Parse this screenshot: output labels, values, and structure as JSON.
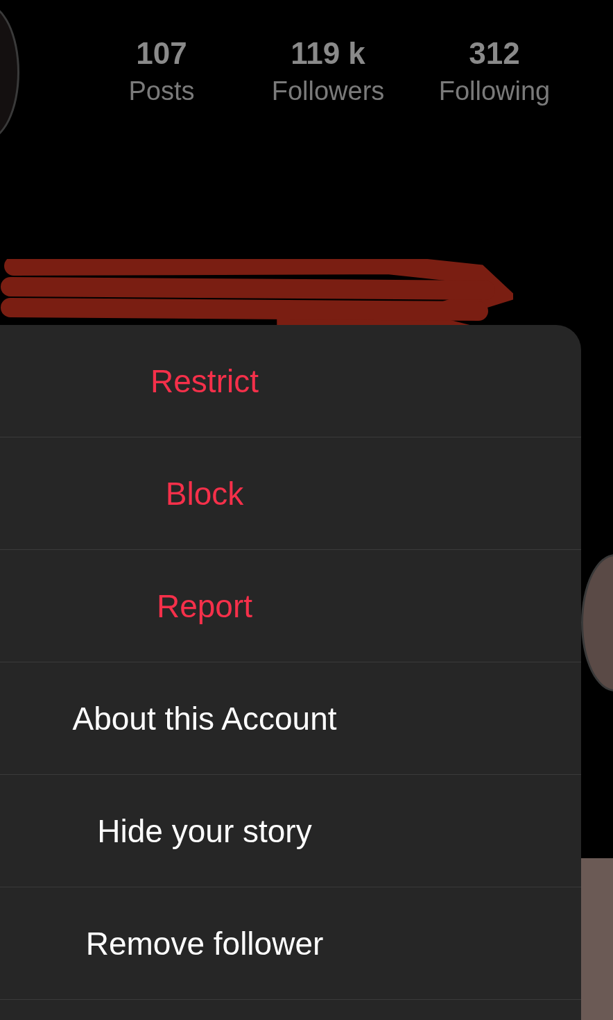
{
  "profile_stats": [
    {
      "value": "107",
      "label": "Posts"
    },
    {
      "value": "119 k",
      "label": "Followers"
    },
    {
      "value": "312",
      "label": "Following"
    }
  ],
  "action_sheet": {
    "items": [
      {
        "label": "Restrict",
        "kind": "destructive"
      },
      {
        "label": "Block",
        "kind": "destructive"
      },
      {
        "label": "Report",
        "kind": "destructive"
      },
      {
        "label": "About this Account",
        "kind": "default"
      },
      {
        "label": "Hide your story",
        "kind": "default"
      },
      {
        "label": "Remove follower",
        "kind": "default"
      }
    ]
  }
}
